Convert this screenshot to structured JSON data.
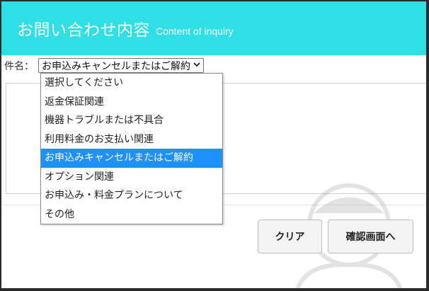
{
  "header": {
    "title": "お問い合わせ内容",
    "subtitle": "Content of inquiry",
    "bg_color": "#2ee0e6"
  },
  "subject": {
    "label": "件名：",
    "selected_value": "お申込みキャンセルまたはご解約",
    "chevron_icon": "chevron-down-icon"
  },
  "dropdown": {
    "options": [
      "選択してください",
      "返金保証関連",
      "機器トラブルまたは不具合",
      "利用料金のお支払い関連",
      "お申込みキャンセルまたはご解約",
      "オプション関連",
      "お申込み・料金プランについて",
      "その他"
    ],
    "selected_index": 4,
    "highlight_color": "#1e90ff"
  },
  "buttons": {
    "clear_label": "クリア",
    "confirm_label": "確認画面へ"
  }
}
